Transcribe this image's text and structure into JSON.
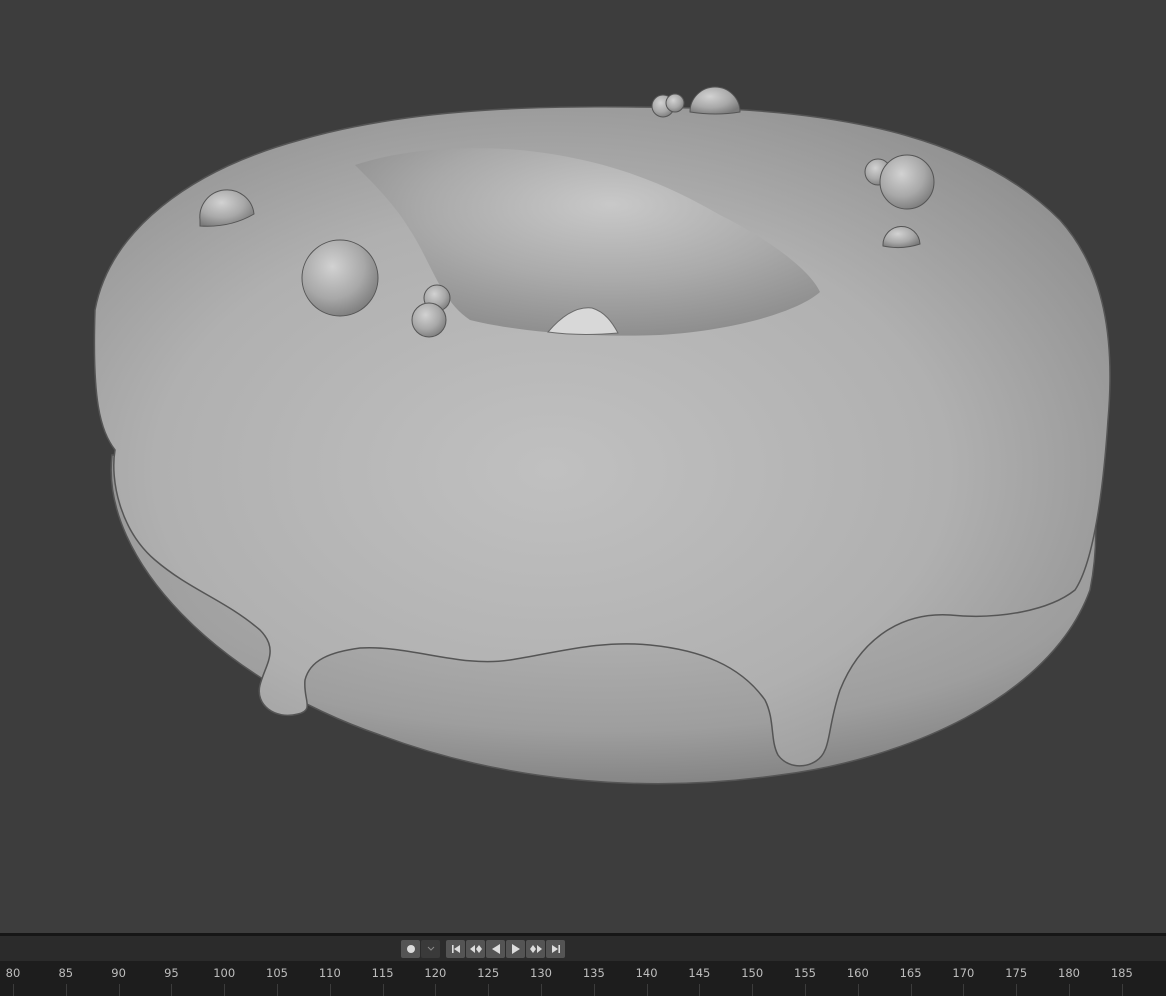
{
  "viewport": {
    "object_icon": "donut-mesh"
  },
  "timeline": {
    "record_icon": "record-icon",
    "keying_dropdown_icon": "chevron-down-icon",
    "playback_icons": [
      "jump-to-start-icon",
      "jump-to-keyframe-prev-icon",
      "play-reverse-icon",
      "play-icon",
      "jump-to-keyframe-next-icon",
      "jump-to-end-icon"
    ],
    "ruler_labels": [
      "80",
      "85",
      "90",
      "95",
      "100",
      "105",
      "110",
      "115",
      "120",
      "125",
      "130",
      "135",
      "140",
      "145",
      "150",
      "155",
      "160",
      "165",
      "170",
      "175",
      "180",
      "185"
    ]
  },
  "colors": {
    "viewport_bg": "#3d3d3d",
    "ruler_bg": "#1d1d1d",
    "header_bg": "#2b2b2b"
  }
}
